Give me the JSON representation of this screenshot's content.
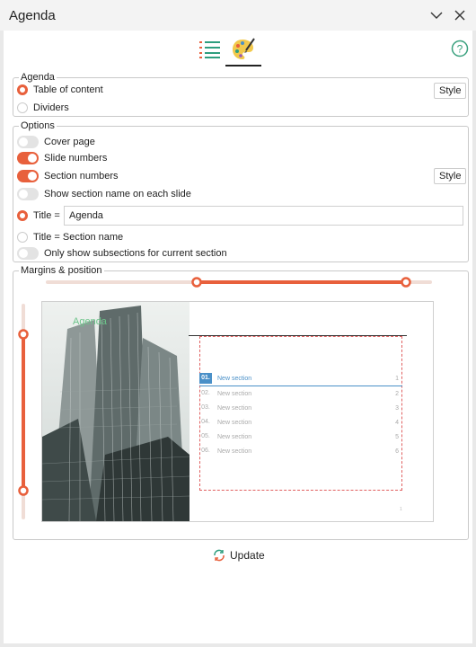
{
  "window": {
    "title": "Agenda"
  },
  "agenda": {
    "legend": "Agenda",
    "items": [
      {
        "label": "Table of content",
        "selected": true
      },
      {
        "label": "Dividers",
        "selected": false
      }
    ],
    "style_label": "Style"
  },
  "options": {
    "legend": "Options",
    "cover_page": "Cover page",
    "slide_numbers": "Slide numbers",
    "section_numbers": "Section numbers",
    "style_label": "Style",
    "show_section_name": "Show section name on each slide",
    "title_prefix": "Title =",
    "title_value": "Agenda",
    "title_section_name": "Title = Section name",
    "only_subsections": "Only show subsections for current section"
  },
  "margins": {
    "legend": "Margins & position"
  },
  "preview": {
    "title": "Agenda",
    "sections": [
      {
        "number": "01.",
        "name": "New section",
        "page": "1"
      },
      {
        "number": "02.",
        "name": "New section",
        "page": "2"
      },
      {
        "number": "03.",
        "name": "New section",
        "page": "3"
      },
      {
        "number": "04.",
        "name": "New section",
        "page": "4"
      },
      {
        "number": "05.",
        "name": "New section",
        "page": "5"
      },
      {
        "number": "06.",
        "name": "New section",
        "page": "6"
      }
    ],
    "slide_number": "1"
  },
  "update_label": "Update",
  "colors": {
    "accent": "#e8603c",
    "highlight": "#4a90c8",
    "title_green": "#6cc48a"
  }
}
